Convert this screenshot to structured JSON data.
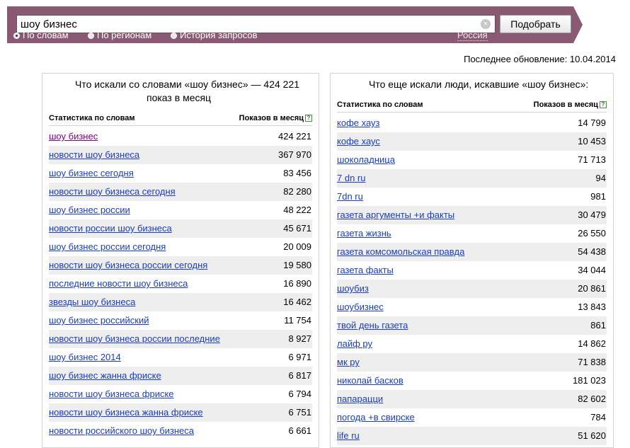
{
  "search": {
    "query": "шоу бизнес",
    "clear_glyph": "×",
    "submit_label": "Подобрать",
    "tabs": [
      {
        "label": "По словам",
        "selected": true
      },
      {
        "label": "По регионам",
        "selected": false
      },
      {
        "label": "История запросов",
        "selected": false
      }
    ],
    "region": "Россия"
  },
  "updated": "Последнее обновление: 10.04.2014",
  "left": {
    "title_line1": "Что искали со словами «шоу бизнес» — 424 221",
    "title_line2": "показ в месяц",
    "col_keyword": "Статистика по словам",
    "col_count": "Показов в месяц",
    "help_icon": "?",
    "rows": [
      {
        "kw": "шоу бизнес",
        "count": "424 221"
      },
      {
        "kw": "новости шоу бизнеса",
        "count": "367 970"
      },
      {
        "kw": "шоу бизнес сегодня",
        "count": "83 456"
      },
      {
        "kw": "новости шоу бизнеса сегодня",
        "count": "82 280"
      },
      {
        "kw": "шоу бизнес россии",
        "count": "48 222"
      },
      {
        "kw": "новости россии шоу бизнеса",
        "count": "45 671"
      },
      {
        "kw": "шоу бизнес россии сегодня",
        "count": "20 009"
      },
      {
        "kw": "новости шоу бизнеса россии сегодня",
        "count": "19 580"
      },
      {
        "kw": "последние новости шоу бизнеса",
        "count": "16 890"
      },
      {
        "kw": "звезды шоу бизнеса",
        "count": "16 462"
      },
      {
        "kw": "шоу бизнес российский",
        "count": "11 754"
      },
      {
        "kw": "новости шоу бизнеса россии последние",
        "count": "8 927"
      },
      {
        "kw": "шоу бизнес 2014",
        "count": "6 971"
      },
      {
        "kw": "шоу бизнес жанна фриске",
        "count": "6 817"
      },
      {
        "kw": "новости шоу бизнеса фриске",
        "count": "6 794"
      },
      {
        "kw": "новости шоу бизнеса жанна фриске",
        "count": "6 751"
      },
      {
        "kw": "новости российского шоу бизнеса",
        "count": "6 661"
      }
    ]
  },
  "right": {
    "title_line1": "Что еще искали люди, искавшие «шоу бизнес»:",
    "col_keyword": "Статистика по словам",
    "col_count": "Показов в месяц",
    "help_icon": "?",
    "rows": [
      {
        "kw": "кофе хауз",
        "count": "14 799"
      },
      {
        "kw": "кофе хаус",
        "count": "10 453"
      },
      {
        "kw": "шоколадница",
        "count": "71 713"
      },
      {
        "kw": "7 dn ru",
        "count": "94"
      },
      {
        "kw": "7dn ru",
        "count": "981"
      },
      {
        "kw": "газета аргументы +и факты",
        "count": "30 479"
      },
      {
        "kw": "газета жизнь",
        "count": "26 550"
      },
      {
        "kw": "газета комсомольская правда",
        "count": "54 438"
      },
      {
        "kw": "газета факты",
        "count": "34 044"
      },
      {
        "kw": "шоубиз",
        "count": "20 861"
      },
      {
        "kw": "шоубизнес",
        "count": "13 843"
      },
      {
        "kw": "твой день газета",
        "count": "861"
      },
      {
        "kw": "лайф ру",
        "count": "14 862"
      },
      {
        "kw": "мк ру",
        "count": "71 838"
      },
      {
        "kw": "николай басков",
        "count": "181 023"
      },
      {
        "kw": "папарацци",
        "count": "82 602"
      },
      {
        "kw": "погода +в свирске",
        "count": "784"
      },
      {
        "kw": "life ru",
        "count": "51 620"
      }
    ]
  },
  "colors": {
    "banner": "#8a5a75",
    "link": "#1a3dc1",
    "visited": "#800080",
    "row_alt": "#eeeeee"
  }
}
